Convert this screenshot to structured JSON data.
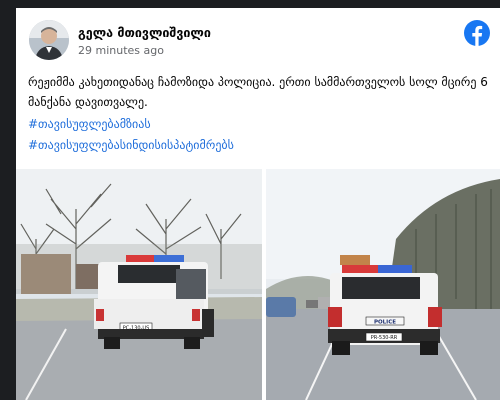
{
  "post": {
    "author": "გელა მთივლიშვილი",
    "timestamp": "29 minutes ago",
    "text": "რეჟიმმა კახეთიდანაც ჩამოზიდა პოლიცია. ერთი სამმართველოს სოლ მცირე 6 მანქანა დავითვალე.",
    "hashtags": [
      "#თავისუფლებამზიას",
      "#თავისუფლებასინდისისპატიმრებს"
    ]
  },
  "photos": {
    "left_plate": "PC-130-US",
    "right_plate": "PR-530-RR",
    "right_vehicle_label": "POLICE"
  },
  "icons": {
    "platform": "facebook-logo-icon"
  },
  "colors": {
    "facebook_blue": "#1877f2",
    "hashtag": "#216fdb",
    "meta_text": "#65676b"
  }
}
